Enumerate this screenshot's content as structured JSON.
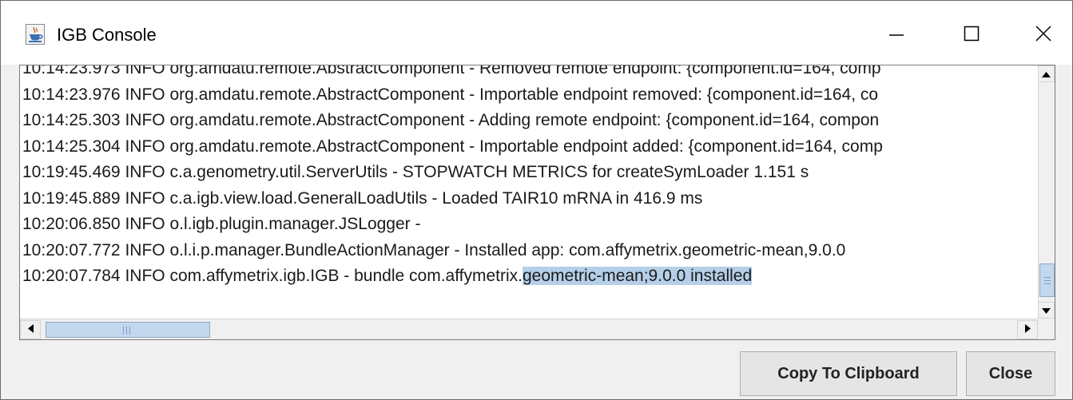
{
  "window": {
    "title": "IGB Console",
    "app_icon": "java-cup-icon"
  },
  "title_controls": {
    "minimize_icon": "minimize-icon",
    "maximize_icon": "maximize-icon",
    "close_icon": "close-icon"
  },
  "console": {
    "lines": [
      "10:14:23.973 INFO  org.amdatu.remote.AbstractComponent - Removed remote endpoint: {component.id=164, comp",
      "10:14:23.976 INFO  org.amdatu.remote.AbstractComponent - Importable endpoint removed: {component.id=164, co",
      "10:14:25.303 INFO  org.amdatu.remote.AbstractComponent - Adding remote endpoint: {component.id=164, compon",
      "10:14:25.304 INFO  org.amdatu.remote.AbstractComponent - Importable endpoint added: {component.id=164, comp",
      "10:19:45.469 INFO  c.a.genometry.util.ServerUtils - STOPWATCH METRICS for createSymLoader 1.151 s",
      "10:19:45.889 INFO  c.a.igb.view.load.GeneralLoadUtils - Loaded TAIR10 mRNA in 416.9 ms",
      "10:20:06.850 INFO  o.l.igb.plugin.manager.JSLogger -",
      "10:20:07.772 INFO  o.l.i.p.manager.BundleActionManager - Installed app: com.affymetrix.geometric-mean,9.0.0"
    ],
    "last_line_prefix": "10:20:07.784 INFO  com.affymetrix.igb.IGB - bundle com.affymetrix.",
    "last_line_selected": "geometric-mean;9.0.0 installed",
    "selection_color": "#b5cfe8"
  },
  "scrollbars": {
    "up_icon": "scroll-up-arrow-icon",
    "down_icon": "scroll-down-arrow-icon",
    "left_icon": "scroll-left-arrow-icon",
    "right_icon": "scroll-right-arrow-icon"
  },
  "buttons": {
    "copy_label": "Copy To Clipboard",
    "close_label": "Close"
  }
}
